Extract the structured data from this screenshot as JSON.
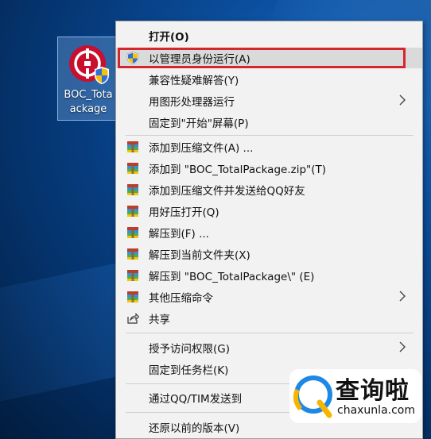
{
  "desktop": {
    "icon_label_line1": "BOC_Tota",
    "icon_label_line2": "ackage"
  },
  "menu": {
    "items": [
      {
        "label": "打开(O)",
        "icon": "none",
        "bold": true
      },
      {
        "label": "以管理员身份运行(A)",
        "icon": "uac-shield-icon",
        "highlighted": true,
        "annotated": true
      },
      {
        "label": "兼容性疑难解答(Y)",
        "icon": "none"
      },
      {
        "label": "用图形处理器运行",
        "icon": "none",
        "submenu": true
      },
      {
        "label": "固定到\"开始\"屏幕(P)",
        "icon": "none"
      },
      {
        "label": "添加到压缩文件(A) ...",
        "icon": "archive-icon"
      },
      {
        "label": "添加到 \"BOC_TotalPackage.zip\"(T)",
        "icon": "archive-icon"
      },
      {
        "label": "添加到压缩文件并发送给QQ好友",
        "icon": "archive-icon"
      },
      {
        "label": "用好压打开(Q)",
        "icon": "archive-icon"
      },
      {
        "label": "解压到(F) ...",
        "icon": "archive-icon"
      },
      {
        "label": "解压到当前文件夹(X)",
        "icon": "archive-icon"
      },
      {
        "label": "解压到 \"BOC_TotalPackage\\\" (E)",
        "icon": "archive-icon"
      },
      {
        "label": "其他压缩命令",
        "icon": "archive-icon",
        "submenu": true
      },
      {
        "label": "共享",
        "icon": "share-icon"
      },
      {
        "label": "授予访问权限(G)",
        "icon": "none",
        "submenu": true
      },
      {
        "label": "固定到任务栏(K)",
        "icon": "none"
      },
      {
        "label": "通过QQ/TIM发送到",
        "icon": "none"
      },
      {
        "label": "还原以前的版本(V)",
        "icon": "none"
      }
    ]
  },
  "watermark": {
    "title": "查询啦",
    "url": "chaxunla.com"
  },
  "colors": {
    "annotation_red": "#d6262d",
    "highlight": "#dadada",
    "menu_bg": "#f2f2f2"
  }
}
